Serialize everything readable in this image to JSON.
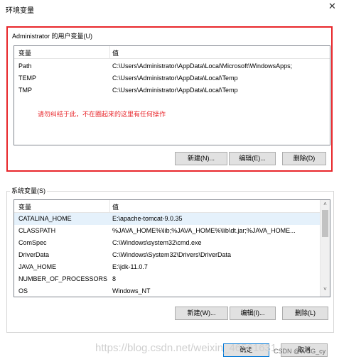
{
  "window": {
    "title": "环境变量",
    "close_glyph": "✕"
  },
  "user_vars": {
    "label": "Administrator 的用户变量(U)",
    "columns": [
      "变量",
      "值"
    ],
    "rows": [
      {
        "name": "Path",
        "value": "C:\\Users\\Administrator\\AppData\\Local\\Microsoft\\WindowsApps;"
      },
      {
        "name": "TEMP",
        "value": "C:\\Users\\Administrator\\AppData\\Local\\Temp"
      },
      {
        "name": "TMP",
        "value": "C:\\Users\\Administrator\\AppData\\Local\\Temp"
      }
    ],
    "note": "请勿纠结于此，不在圈起来的这里有任何操作",
    "buttons": {
      "new": "新建(N)...",
      "edit": "编辑(E)...",
      "delete": "删除(D)"
    }
  },
  "system_vars": {
    "label": "系统变量(S)",
    "columns": [
      "变量",
      "值"
    ],
    "rows": [
      {
        "name": "CATALINA_HOME",
        "value": "E:\\apache-tomcat-9.0.35"
      },
      {
        "name": "CLASSPATH",
        "value": "%JAVA_HOME%\\lib;%JAVA_HOME%\\lib\\dt.jar;%JAVA_HOME..."
      },
      {
        "name": "ComSpec",
        "value": "C:\\Windows\\system32\\cmd.exe"
      },
      {
        "name": "DriverData",
        "value": "C:\\Windows\\System32\\Drivers\\DriverData"
      },
      {
        "name": "JAVA_HOME",
        "value": "E:\\jdk-11.0.7"
      },
      {
        "name": "NUMBER_OF_PROCESSORS",
        "value": "8"
      },
      {
        "name": "OS",
        "value": "Windows_NT"
      }
    ],
    "scroll_up": "˄",
    "scroll_down": "˅",
    "buttons": {
      "new": "新建(W)...",
      "edit": "编辑(I)...",
      "delete": "删除(L)"
    }
  },
  "dialog_buttons": {
    "ok": "确定",
    "cancel": "取消"
  },
  "watermark": "https://blog.csdn.net/weixin_46561631",
  "csdn_credit": "CSDN @WCG_cy"
}
